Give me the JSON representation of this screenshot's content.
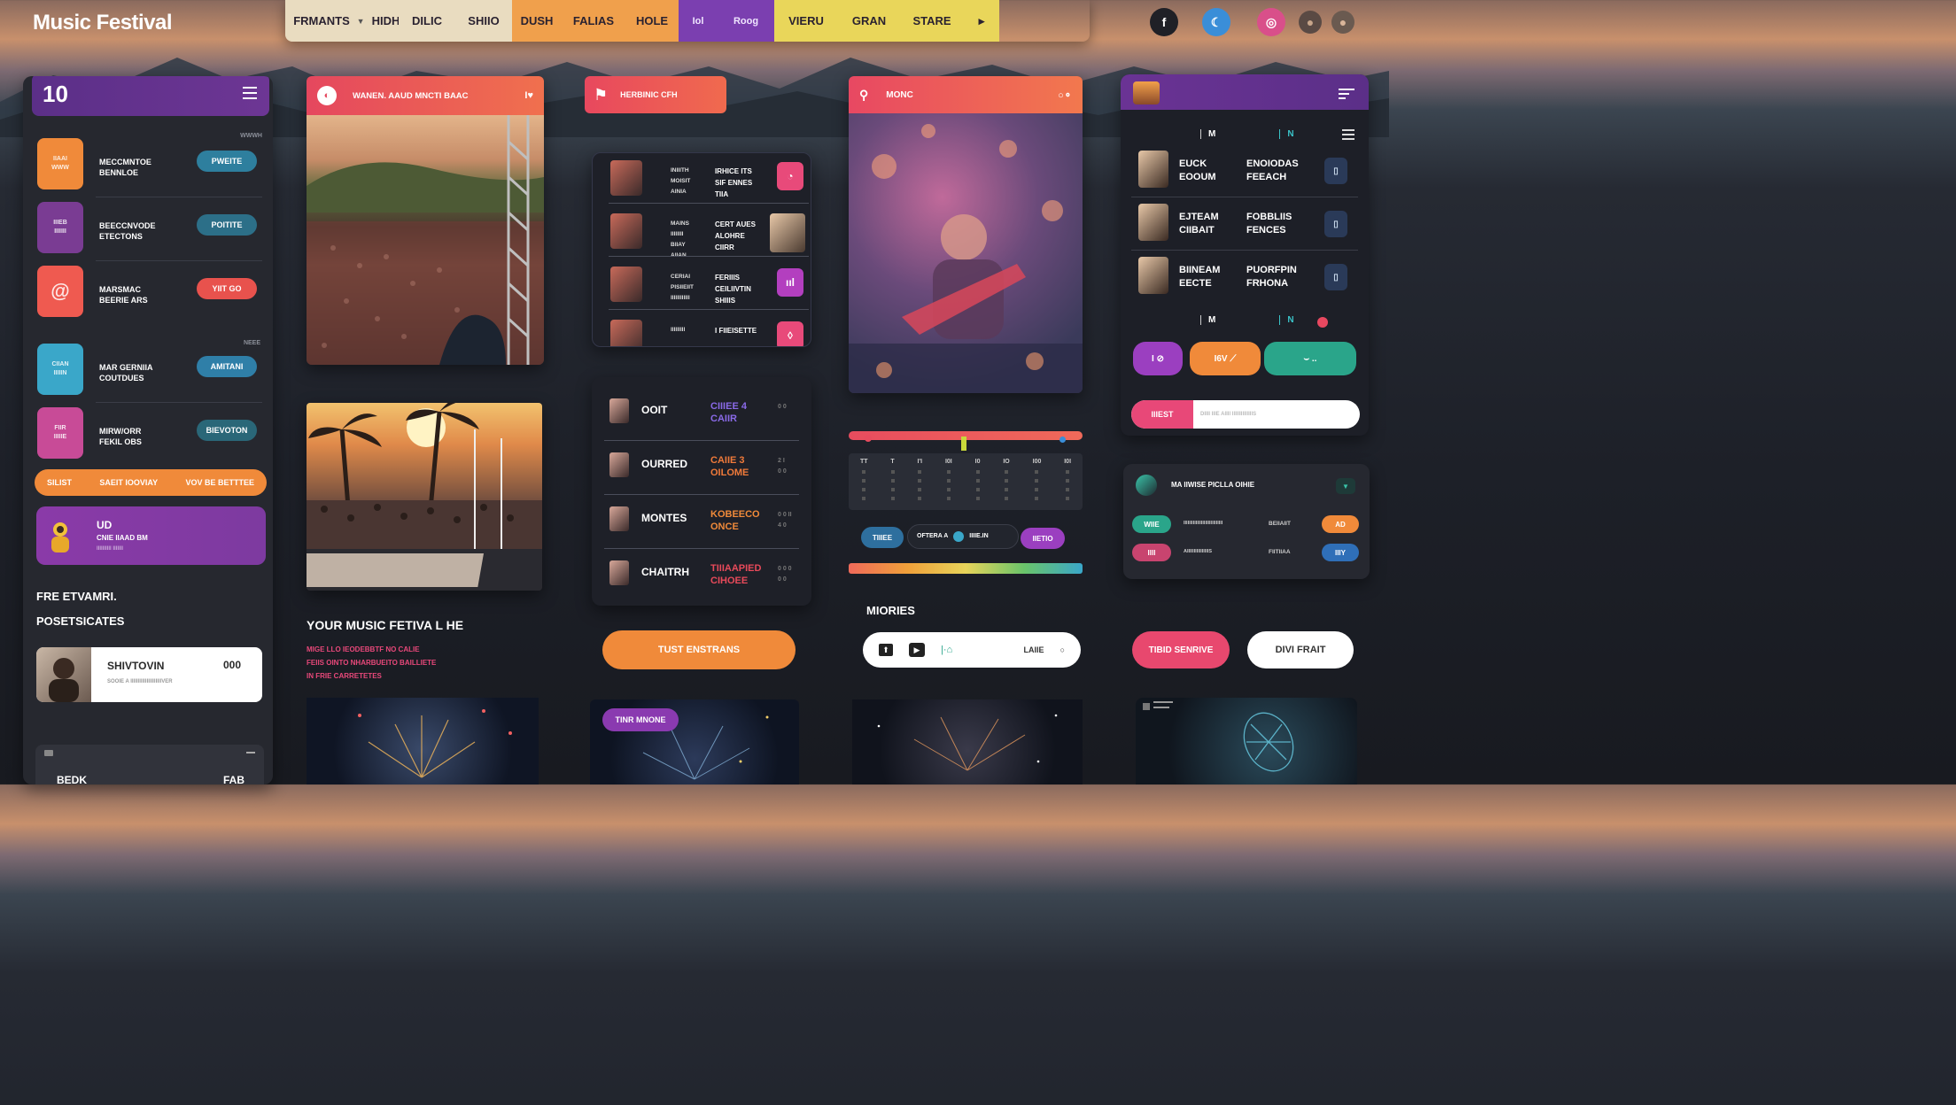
{
  "app": {
    "title": "Music Festival"
  },
  "nav": [
    {
      "label": "FRMANTS",
      "bg": "#e9dcc0"
    },
    {
      "label": "HIDH",
      "bg": "#e9dcc0",
      "icon": "chevron-down-icon"
    },
    {
      "label": "DILIC",
      "bg": "#e9dcc0"
    },
    {
      "label": "SHIIO",
      "bg": "#e9dcc0"
    },
    {
      "label": "DUSH",
      "bg": "#f0a04c"
    },
    {
      "label": "FALIAS",
      "bg": "#f0a04c"
    },
    {
      "label": "HOLE",
      "bg": "#f0a04c"
    },
    {
      "label": "Iol",
      "bg": "#7b3fb0"
    },
    {
      "label": "Roog",
      "bg": "#7b3fb0"
    },
    {
      "label": "VIERU",
      "bg": "#e9d65a"
    },
    {
      "label": "GRAN",
      "bg": "#e9d65a"
    },
    {
      "label": "STARE",
      "bg": "#e9d65a"
    },
    {
      "label": "▸",
      "bg": "#e9d65a"
    }
  ],
  "social": [
    {
      "name": "facebook-icon",
      "glyph": "f",
      "bg": "#1f2026",
      "fg": "#ffffff"
    },
    {
      "name": "messenger-icon",
      "glyph": "☾",
      "bg": "#3a8ed8",
      "fg": "#ffffff"
    },
    {
      "name": "instagram-icon",
      "glyph": "◎",
      "bg": "#d94f8a",
      "fg": "#ffffff"
    },
    {
      "name": "avatar-icon",
      "glyph": "●",
      "bg": "#5a4a44",
      "fg": "#c7a58a"
    },
    {
      "name": "avatar-icon",
      "glyph": "●",
      "bg": "#6a5a50",
      "fg": "#d9b59a"
    }
  ],
  "left_panel": {
    "number": "10",
    "corner_label": "WWWH",
    "items": [
      {
        "icon_text": "IIAAI\nWWW",
        "icon_bg": "#f08a3a",
        "title": "MECCMNTOE\nBENNLOE",
        "btn": "PWEITE",
        "btn_bg": "#2e7f9e"
      },
      {
        "icon_text": "IIIEB\nIIIIIII",
        "icon_bg": "#7a3c93",
        "title": "BEECCNVODE\nETECTONS",
        "btn": "POITITE",
        "btn_bg": "#2c6f88"
      },
      {
        "icon_text": "@",
        "icon_bg": "#ef5a50",
        "title": "MARSMAC\nBEERIE ARS",
        "btn": "YIIT GO",
        "btn_bg": "#e8524d"
      },
      {
        "icon_text": "CIIAN\nIIIIIN",
        "icon_bg": "#3aa7c9",
        "title": "MAR GERNIIA\nCOUTDUES",
        "btn": "AMITANI",
        "btn_bg": "#2f7fa8"
      },
      {
        "icon_text": "FIIR\nIIIIIE",
        "icon_bg": "#c84b97",
        "title": "MIRW/ORR\nFEKIL OBS",
        "btn": "BIEVOTON",
        "btn_bg": "#2a6778"
      }
    ],
    "small_label": "NEEE",
    "orange_bar": [
      "SILIST",
      "SAEIT IOOVIAY",
      "VOV BE BETTTEE"
    ],
    "promo": {
      "title": "UD",
      "sub": "CNIE IIAAD BM",
      "sub2": "IIIIIIIIII IIIIIII"
    },
    "free_title": "FRE ETVAMRI.",
    "postcard_title": "POSETSICATES",
    "profile": {
      "name": "SHIVTOVIN",
      "count": "000",
      "sub": "SOOIE A IIIIIIIIIIIIIIIIIIIIIVER"
    },
    "bottom": {
      "left": "BEDK",
      "right": "FAB"
    }
  },
  "col2": {
    "card1_title": "WANEN. AAUD MNCTI BAAC",
    "heading": "YOUR  MUSIC FETIVA L HE",
    "body_lines": [
      "MIGE LLO IEODEBBTF NO CALIE",
      "FEIIS  OINTO NHARBUEITO BAILLIETE",
      "IN  FRIE  CARRETETES"
    ]
  },
  "col3": {
    "tag": "HERBINIC CFH",
    "schedule": [
      {
        "a": "INIIITH\nMOISIT\nAINIA",
        "b": "IRHICE ITS\nSIF ENNES\nTIIA",
        "btn_bg": "#e84a7a",
        "btn": "◔"
      },
      {
        "a": "MAINS\nIIIIIIII\nBIIAY\nAIIAN",
        "b": "CERT AUES\nALOHRE\nCIIRR",
        "btn_bg": "",
        "btn": ""
      },
      {
        "a": "CERIAI\nPISIIEIIT\nIIIIIIIIIIII",
        "b": "FERIIIS\nCEILIIVTIN\nSHIIIS",
        "btn_bg": "#b33fbf",
        "btn": "ııl"
      },
      {
        "a": "IIIIIIIII",
        "b": "I FIIEISETTE",
        "btn_bg": "#e84a7a",
        "btn": "◊"
      }
    ],
    "lineup": [
      {
        "name": "OOIT",
        "info": "CIIIEE 4\nCAIIR",
        "num": "0 0"
      },
      {
        "name": "OURRED",
        "info": "CAIIE 3\nOILOME",
        "num": "2 I\n0 0"
      },
      {
        "name": "MONTES",
        "info": "KOBEECO\nONCE",
        "num": "0 0 II\n4 0"
      },
      {
        "name": "CHAITRH",
        "info": "TIIIAAPIED\nCIHOEE",
        "num": "0 0 0\n0 0"
      }
    ],
    "cta": "TUST ENSTRANS",
    "badge": "TINR MNONE"
  },
  "col4": {
    "title": "MONC",
    "days": [
      "TT",
      "T",
      "I'I",
      "I0I",
      "I0",
      "IO",
      "I00",
      "I0I"
    ],
    "pill_left": "TIIIEE",
    "pill_mid": "OFTERA A",
    "pill_mid2": "IIIIE.IN",
    "pill_right": "IIETIO",
    "more": "MIORIES",
    "player_label": "LAIIE"
  },
  "col5": {
    "tabs": [
      "M",
      "",
      "N"
    ],
    "rows": [
      {
        "name": "EUCK\nEOOUM",
        "event": "ENOIODAS\nFEEACH"
      },
      {
        "name": "EJTEAM\nCIIBAIT",
        "event": "FOBBLIIS\nFENCES"
      },
      {
        "name": "BIINEAM\nEECTE",
        "event": "PUORFPIN\nFRHONA"
      }
    ],
    "btns": [
      {
        "label": "I ⊘",
        "bg": "#9b3fc0"
      },
      {
        "label": "I6V ⟋",
        "bg": "#f08a3a"
      },
      {
        "label": "⌣ ..",
        "bg": "#2aa58a"
      }
    ],
    "search_tag": "IIIEST",
    "search_placeholder": "DIIII IIIE AIIII IIIIIIIIIIIIIIS",
    "card_title": "MA IIWISE PICLLA OIHIE",
    "mini_rows": [
      {
        "tag": "WIIE",
        "tag_bg": "#2aa58a",
        "txt": "IIIIIIIIIIIIIIIIIIIIIIIIIIIII",
        "txt2": "BEIIAIIT",
        "btn": "AD",
        "btn_bg": "#f08a3a"
      },
      {
        "tag": "IIII",
        "tag_bg": "#c8446f",
        "txt": "AIIIIIIIIIIIIIIIIS",
        "txt2": "FIITIIAA",
        "btn": "IIIY",
        "btn_bg": "#2f6fb8"
      }
    ],
    "btn_pink": "TIBID SENRIVE",
    "btn_white": "DIVI FRAIT"
  }
}
